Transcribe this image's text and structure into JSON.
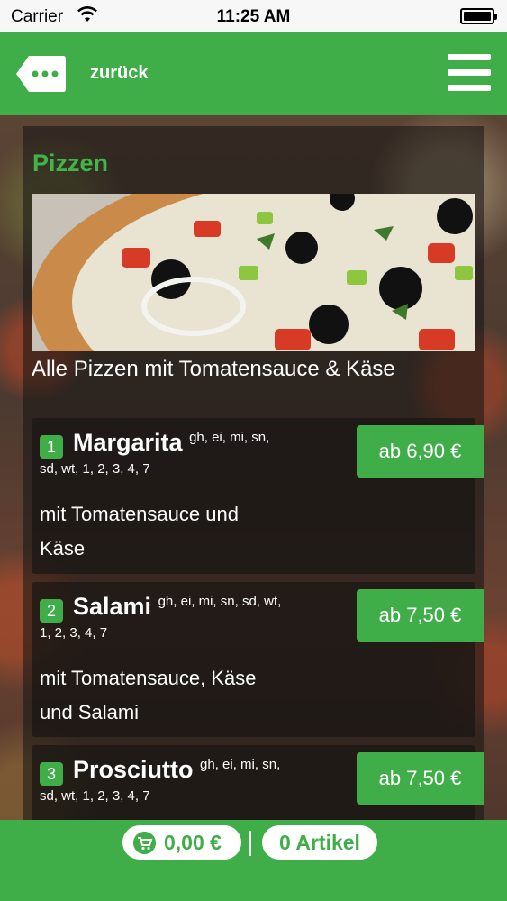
{
  "status_bar": {
    "carrier": "Carrier",
    "time": "11:25 AM"
  },
  "header": {
    "back_label": "zurück",
    "back_icon": "chat-dots-icon",
    "menu_icon": "hamburger-menu-icon"
  },
  "category": {
    "title": "Pizzen",
    "description": "Alle Pizzen mit Tomatensauce & Käse"
  },
  "items": [
    {
      "number": "1",
      "name": "Margarita",
      "tags": "gh, ei, mi, sn,",
      "tags_line2": "sd, wt, 1, 2, 3, 4, 7",
      "description_line1": "mit Tomatensauce und",
      "description_line2": "Käse",
      "price": "ab 6,90 €"
    },
    {
      "number": "2",
      "name": "Salami",
      "tags": "gh, ei, mi, sn, sd, wt,",
      "tags_line2": "1, 2, 3, 4, 7",
      "description_line1": "mit Tomatensauce, Käse",
      "description_line2": "und Salami",
      "price": "ab 7,50 €"
    },
    {
      "number": "3",
      "name": "Prosciutto",
      "tags": "gh, ei, mi, sn,",
      "tags_line2": "sd, wt, 1, 2, 3, 4, 7",
      "description_line1": "",
      "description_line2": "",
      "price": "ab 7,50 €"
    }
  ],
  "footer": {
    "cart_total": "0,00 €",
    "cart_icon": "shopping-cart-icon",
    "item_count": "0 Artikel"
  },
  "colors": {
    "brand_green": "#3fae49",
    "title_green": "#41b548"
  }
}
